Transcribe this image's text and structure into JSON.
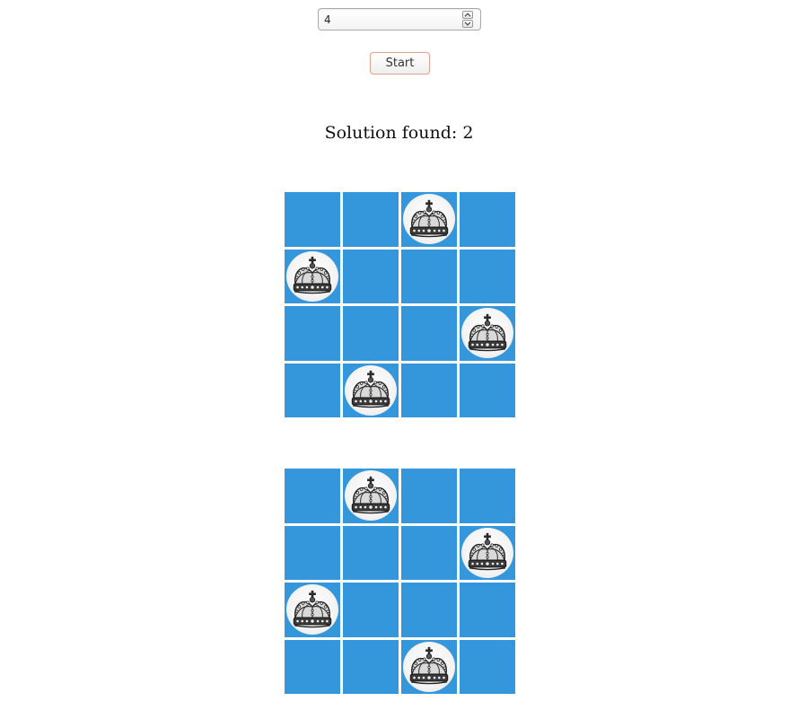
{
  "controls": {
    "board_size_value": "4",
    "start_label": "Start"
  },
  "status": {
    "text": "Solution found: 2"
  },
  "boards": [
    {
      "size": 4,
      "queens": [
        2,
        0,
        3,
        1
      ]
    },
    {
      "size": 4,
      "queens": [
        1,
        3,
        0,
        2
      ]
    }
  ],
  "colors": {
    "board_cell": "#3497db",
    "grid_lines": "#ffffff",
    "start_border": "#e0a48f"
  },
  "icons": {
    "queen": "crown-icon",
    "spin_up": "chevron-up-icon",
    "spin_down": "chevron-down-icon"
  }
}
